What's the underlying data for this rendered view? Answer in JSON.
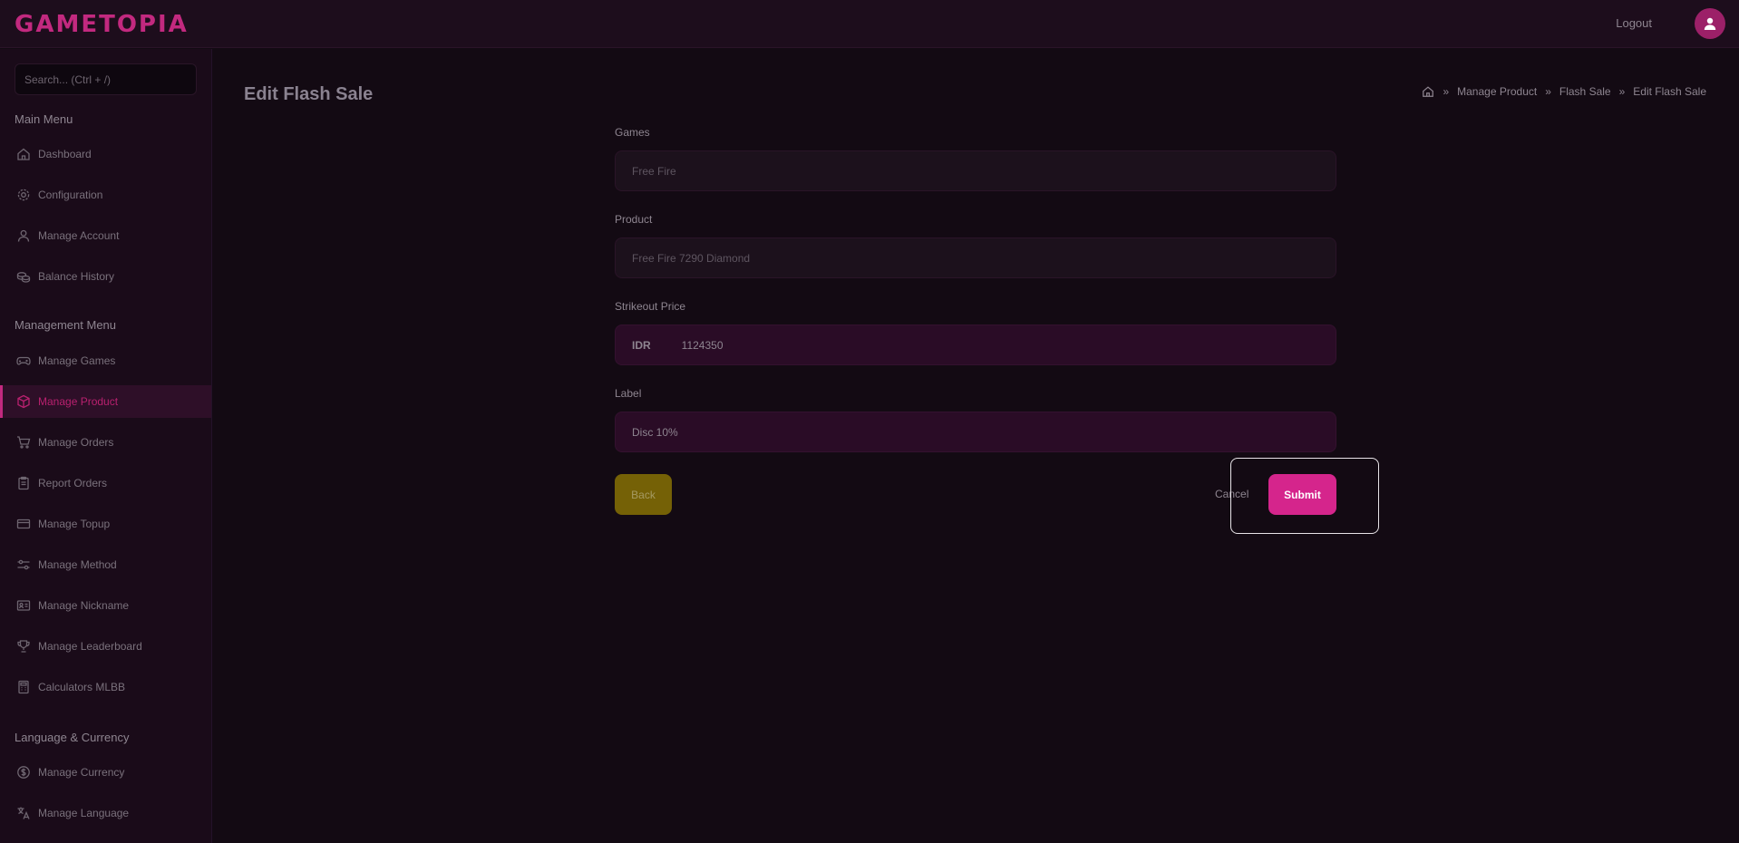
{
  "header": {
    "logo": "GAMETOPIA",
    "logout_label": "Logout"
  },
  "sidebar": {
    "search_placeholder": "Search... (Ctrl + /)",
    "sections": [
      {
        "title": "Main Menu"
      },
      {
        "title": "Management Menu"
      },
      {
        "title": "Language & Currency"
      }
    ],
    "items": [
      {
        "label": "Dashboard",
        "icon": "home-icon"
      },
      {
        "label": "Configuration",
        "icon": "gear-icon"
      },
      {
        "label": "Manage Account",
        "icon": "user-icon"
      },
      {
        "label": "Balance History",
        "icon": "coins-icon"
      },
      {
        "label": "Manage Games",
        "icon": "gamepad-icon"
      },
      {
        "label": "Manage Product",
        "icon": "box-icon",
        "active": true
      },
      {
        "label": "Manage Orders",
        "icon": "cart-icon"
      },
      {
        "label": "Report Orders",
        "icon": "clipboard-icon"
      },
      {
        "label": "Manage Topup",
        "icon": "credit-card-icon"
      },
      {
        "label": "Manage Method",
        "icon": "sliders-icon"
      },
      {
        "label": "Manage Nickname",
        "icon": "id-card-icon"
      },
      {
        "label": "Manage Leaderboard",
        "icon": "trophy-icon"
      },
      {
        "label": "Calculators MLBB",
        "icon": "calculator-icon"
      },
      {
        "label": "Manage Currency",
        "icon": "dollar-circle-icon"
      },
      {
        "label": "Manage Language",
        "icon": "translate-icon"
      }
    ]
  },
  "main": {
    "title": "Edit Flash Sale",
    "breadcrumb": [
      "Manage Product",
      "Flash Sale",
      "Edit Flash Sale"
    ],
    "form": {
      "games_label": "Games",
      "games_value": "Free Fire",
      "product_label": "Product",
      "product_value": "Free Fire 7290 Diamond",
      "strikeout_label": "Strikeout Price",
      "strikeout_prefix": "IDR",
      "strikeout_value": "1124350",
      "label_label": "Label",
      "label_value": "Disc 10%"
    },
    "buttons": {
      "back": "Back",
      "cancel": "Cancel",
      "submit": "Submit"
    }
  },
  "colors": {
    "accent": "#c2297f",
    "background": "#130a13",
    "sidebar": "#1a0b19",
    "back_button": "#756106",
    "submit_button": "#d5258c"
  }
}
